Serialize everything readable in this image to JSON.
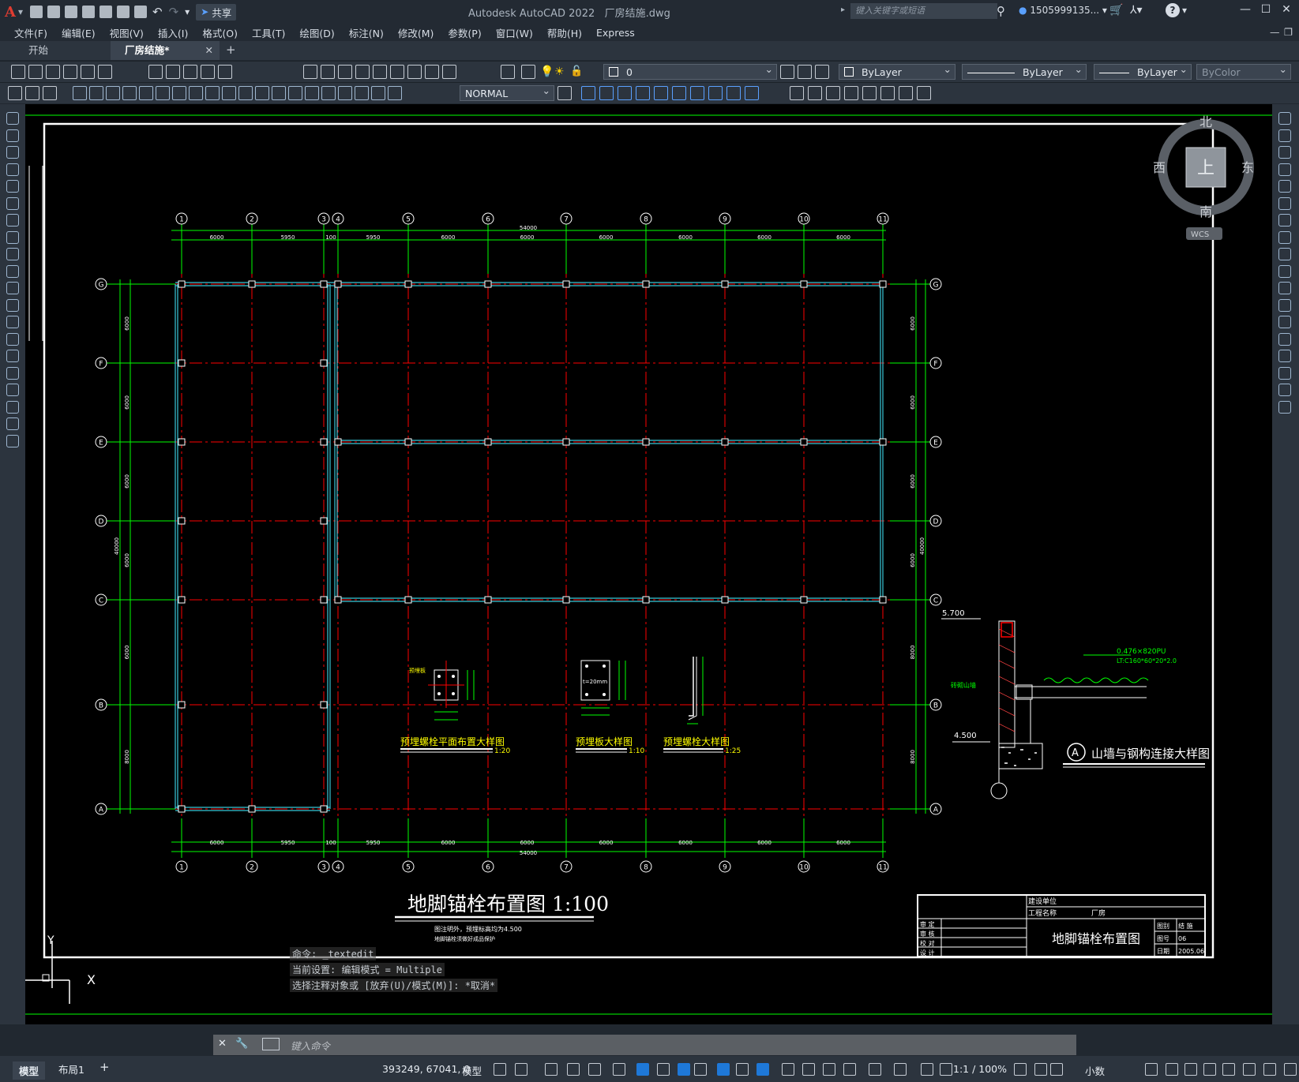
{
  "app": {
    "logo": "A",
    "title": "Autodesk AutoCAD 2022",
    "file": "厂房结施.dwg",
    "share_label": "共享",
    "search_placeholder": "键入关键字或短语",
    "user": "1505999135...",
    "help": "?"
  },
  "menu": [
    "文件(F)",
    "编辑(E)",
    "视图(V)",
    "插入(I)",
    "格式(O)",
    "工具(T)",
    "绘图(D)",
    "标注(N)",
    "修改(M)",
    "参数(P)",
    "窗口(W)",
    "帮助(H)",
    "Express"
  ],
  "tabs": {
    "start": "开始",
    "active": "厂房结施*",
    "close": "✕",
    "new": "+"
  },
  "props": {
    "layer": "0",
    "color": "ByLayer",
    "linetype": "ByLayer",
    "lineweight": "ByLayer",
    "plotstyle": "ByColor",
    "dimstyle": "NORMAL"
  },
  "viewcube": {
    "north": "北",
    "south": "南",
    "east": "东",
    "west": "西",
    "face": "上",
    "wcs": "WCS"
  },
  "drawing": {
    "axis_nums": [
      "1",
      "2",
      "3",
      "4",
      "5",
      "6",
      "7",
      "8",
      "9",
      "10",
      "11"
    ],
    "axis_letters": [
      "G",
      "F",
      "E",
      "D",
      "C",
      "B",
      "A"
    ],
    "top_dims": [
      "6000",
      "5950",
      "100",
      "5950",
      "6000",
      "6000",
      "6000",
      "6000",
      "6000",
      "6000"
    ],
    "bottom_dims": [
      "6000",
      "5950",
      "100",
      "5950",
      "6000",
      "6000",
      "6000",
      "6000",
      "6000",
      "6000"
    ],
    "total_width": "54000",
    "left_dims": [
      "6000",
      "6000",
      "6000",
      "6000",
      "6000",
      "8000",
      "8000"
    ],
    "total_height": "40000",
    "right_dims": [
      "6000",
      "6000",
      "6000",
      "6000",
      "8000",
      "8000"
    ],
    "detail1_title": "预埋螺栓平面布置大样图",
    "detail1_scale": "1:20",
    "detail2_title": "预埋板大样图",
    "detail2_scale": "1:10",
    "detail3_title": "预埋螺栓大样图",
    "detail3_scale": "1:25",
    "detail2_note": "t=20mm",
    "detail1_label": "预埋板",
    "section_title": "山墙与钢构连接大样图",
    "section_mark": "A",
    "elev_top": "5.700",
    "elev_bottom": "4.500",
    "section_label1": "0.476×820PU",
    "section_label2": "LT:C160*60*20*2.0",
    "section_wall": "砖砌山墙",
    "main_title": "地脚锚栓布置图  1:100",
    "main_note1": "图注明外，预埋标高均为4.500",
    "main_note2": "地脚锚栓须做好成品保护",
    "tb_unit": "建设单位",
    "tb_project": "工程名称",
    "tb_project_val": "厂房",
    "tb_name": "地脚锚栓布置图",
    "tb_rows": [
      "审 定",
      "审 核",
      "校 对",
      "设 计"
    ],
    "tb_right": [
      "图别",
      "结 施",
      "图号",
      "06",
      "日期",
      "2005.06"
    ],
    "ucs_y": "Y",
    "ucs_x": "X"
  },
  "command": {
    "line1": "命令: _textedit",
    "line2": "当前设置: 编辑模式 = Multiple",
    "line3": "选择注释对象或 [放弃(U)/模式(M)]: *取消*",
    "placeholder": "键入命令"
  },
  "status": {
    "model_tab": "模型",
    "layout_tab": "布局1",
    "add_tab": "+",
    "coords": "393249, 67041, 0",
    "model_label": "模型",
    "scale": "1:1 / 100%",
    "units": "小数"
  },
  "colors": {
    "grid_green": "#00ff00",
    "axis_red": "#ff0000",
    "beam_cyan": "#38c8d8",
    "text_yellow": "#ffff00",
    "white": "#ffffff",
    "accent_blue": "#1e78d8"
  }
}
